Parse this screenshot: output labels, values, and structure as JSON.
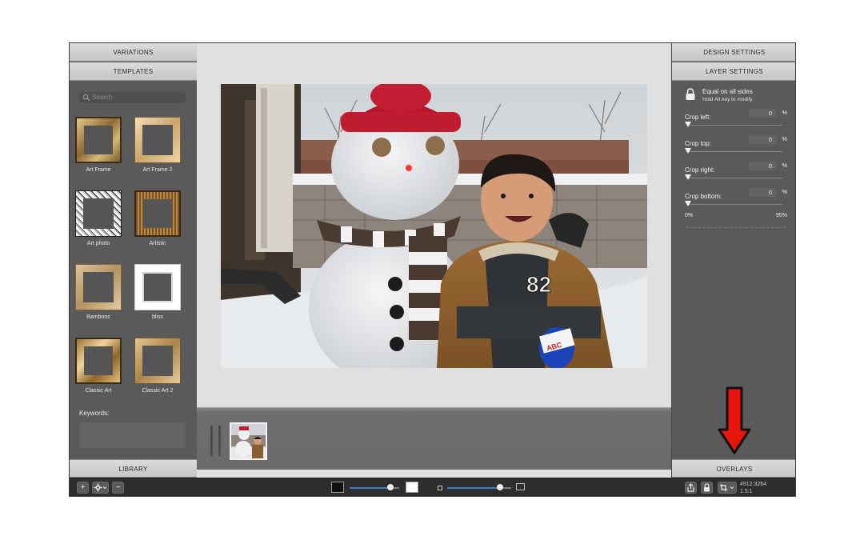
{
  "left_panel": {
    "variations_label": "VARIATIONS",
    "templates_label": "TEMPLATES",
    "search_placeholder": "Search",
    "templates": [
      {
        "label": "Art Frame"
      },
      {
        "label": "Art Frame 2"
      },
      {
        "label": "Art photo"
      },
      {
        "label": "Artistic"
      },
      {
        "label": "Bamboos"
      },
      {
        "label": "bliss"
      },
      {
        "label": "Classic Art"
      },
      {
        "label": "Classic Art 2"
      }
    ],
    "keywords_label": "Keywords:",
    "library_label": "LIBRARY"
  },
  "right_panel": {
    "design_settings_label": "DESIGN SETTINGS",
    "layer_settings_label": "LAYER SETTINGS",
    "lock_title": "Equal on all sides",
    "lock_subtitle": "Hold Alt key to modify",
    "crop_fields": [
      {
        "label": "Crop left:",
        "value": "0",
        "unit": "%"
      },
      {
        "label": "Crop top:",
        "value": "0",
        "unit": "%"
      },
      {
        "label": "Crop right:",
        "value": "0",
        "unit": "%"
      },
      {
        "label": "Crop bottom:",
        "value": "0",
        "unit": "%"
      }
    ],
    "range_min": "0%",
    "range_max": "95%",
    "overlays_label": "OVERLAYS"
  },
  "toolbar": {
    "add_label": "+",
    "remove_label": "−",
    "image_dimensions": "4912:3264",
    "image_scale": "1.5:1"
  },
  "sliders": {
    "brightness_level": 0.82,
    "zoom_level": 0.82
  },
  "colors": {
    "slider_accent": "#3b7bd6",
    "panel_header": "#d6d6d6",
    "annotation_arrow": "#e8150d"
  }
}
